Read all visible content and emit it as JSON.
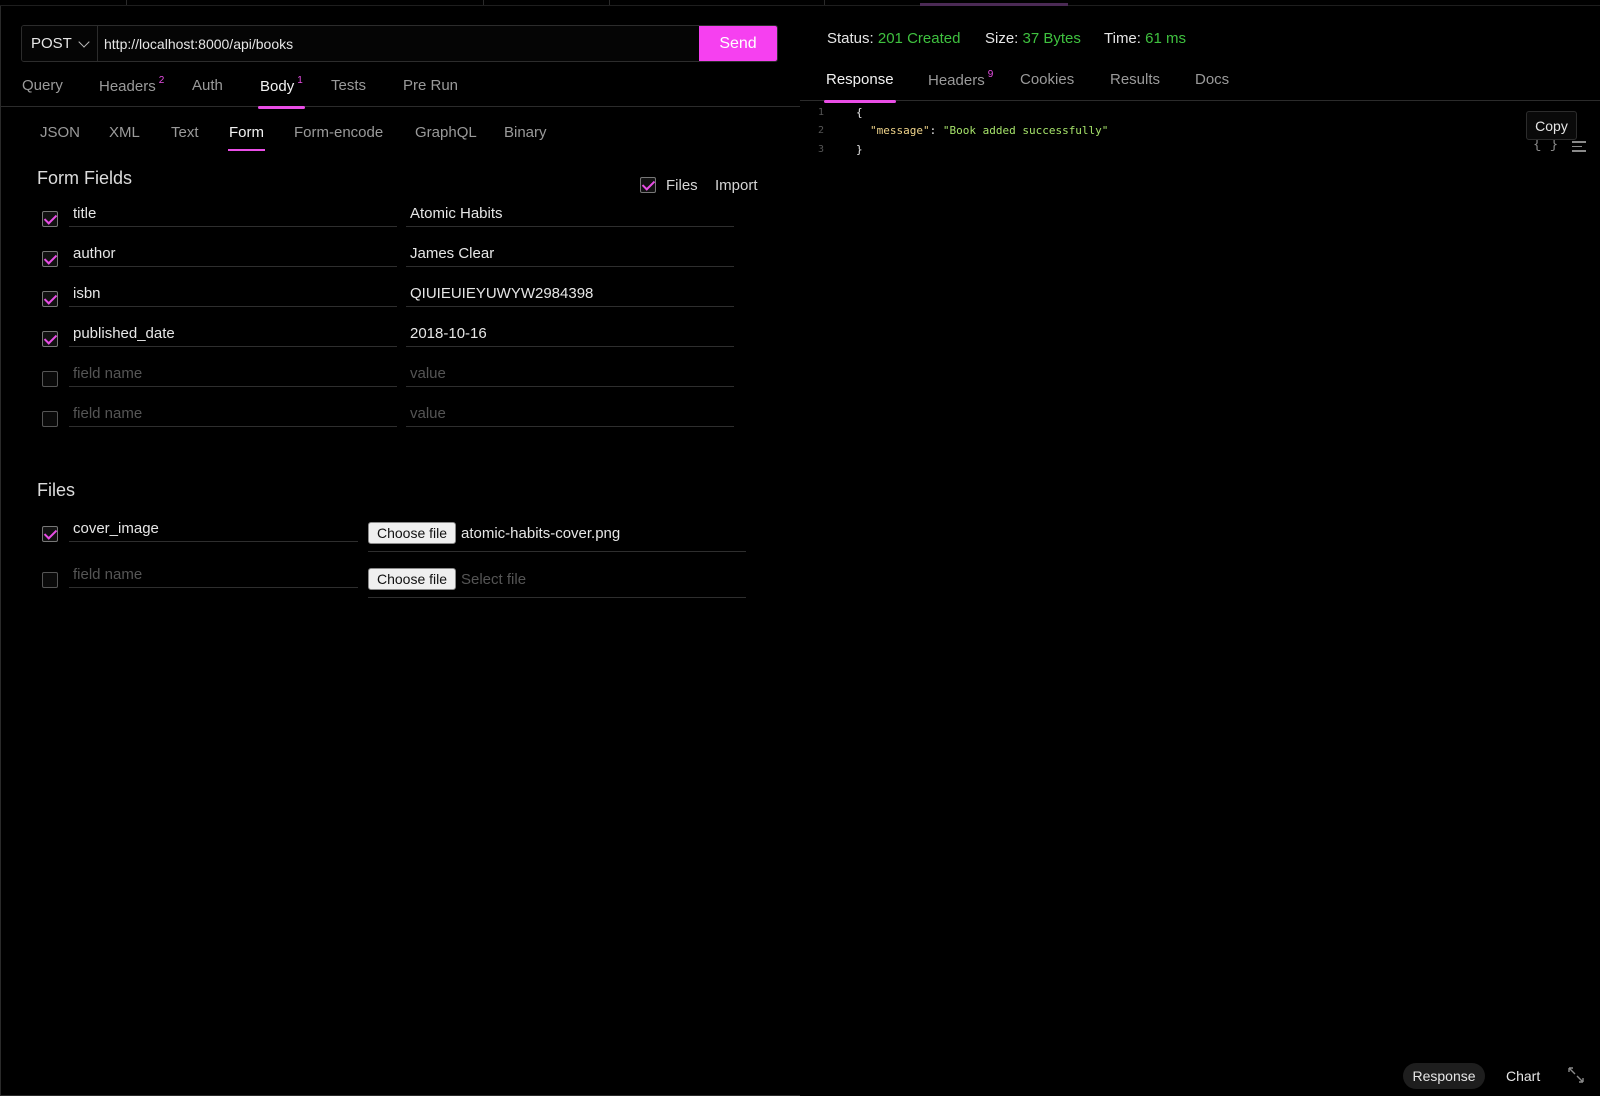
{
  "request": {
    "method": "POST",
    "url": "http://localhost:8000/api/books",
    "send_label": "Send"
  },
  "request_tabs": [
    {
      "label": "Query",
      "badge": ""
    },
    {
      "label": "Headers",
      "badge": "2"
    },
    {
      "label": "Auth",
      "badge": ""
    },
    {
      "label": "Body",
      "badge": "1",
      "active": true
    },
    {
      "label": "Tests",
      "badge": ""
    },
    {
      "label": "Pre Run",
      "badge": ""
    }
  ],
  "body_tabs": [
    "JSON",
    "XML",
    "Text",
    "Form",
    "Form-encode",
    "GraphQL",
    "Binary"
  ],
  "body_active": "Form",
  "form": {
    "title": "Form Fields",
    "files_toggle_label": "Files",
    "import_label": "Import",
    "fields": [
      {
        "checked": true,
        "name": "title",
        "value": "Atomic Habits"
      },
      {
        "checked": true,
        "name": "author",
        "value": "James Clear"
      },
      {
        "checked": true,
        "name": "isbn",
        "value": "QIUIEUIEYUWYW2984398"
      },
      {
        "checked": true,
        "name": "published_date",
        "value": "2018-10-16"
      },
      {
        "checked": false,
        "name": "",
        "value": ""
      },
      {
        "checked": false,
        "name": "",
        "value": ""
      }
    ],
    "name_placeholder": "field name",
    "value_placeholder": "value"
  },
  "files": {
    "title": "Files",
    "choose_label": "Choose file",
    "select_placeholder": "Select file",
    "rows": [
      {
        "checked": true,
        "name": "cover_image",
        "file": "atomic-habits-cover.png"
      },
      {
        "checked": false,
        "name": "",
        "file": ""
      }
    ]
  },
  "response": {
    "status_label": "Status:",
    "status_value": "201 Created",
    "size_label": "Size:",
    "size_value": "37 Bytes",
    "time_label": "Time:",
    "time_value": "61 ms",
    "status_color": "#3fc13f",
    "tabs": [
      {
        "label": "Response",
        "badge": "",
        "active": true
      },
      {
        "label": "Headers",
        "badge": "9"
      },
      {
        "label": "Cookies",
        "badge": ""
      },
      {
        "label": "Results",
        "badge": ""
      },
      {
        "label": "Docs",
        "badge": ""
      }
    ],
    "json_icon": "{ }",
    "copy_label": "Copy",
    "body_lines": [
      {
        "num": "1",
        "text": "{"
      },
      {
        "num": "2",
        "key": "\"message\"",
        "sep": ": ",
        "val": "\"Book added successfully\""
      },
      {
        "num": "3",
        "text": "}"
      }
    ]
  },
  "footer": {
    "response_label": "Response",
    "chart_label": "Chart"
  },
  "accent_color": "#f640f0"
}
